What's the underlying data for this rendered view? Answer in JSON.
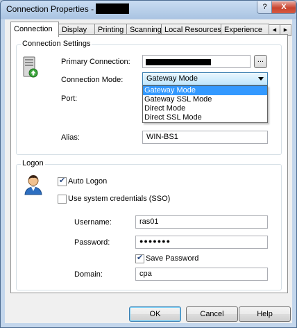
{
  "window": {
    "title": "Connection Properties - ",
    "help_btn": "?",
    "close_btn": "X"
  },
  "tabs": [
    {
      "label": "Connection",
      "active": true
    },
    {
      "label": "Display"
    },
    {
      "label": "Printing"
    },
    {
      "label": "Scanning"
    },
    {
      "label": "Local Resources"
    },
    {
      "label": "Experience"
    }
  ],
  "tab_scroll": {
    "left": "◀",
    "right": "▶"
  },
  "connection_settings": {
    "group_label": "Connection Settings",
    "primary_connection_label": "Primary Connection:",
    "browse_btn": "...",
    "connection_mode_label": "Connection Mode:",
    "connection_mode_value": "Gateway Mode",
    "connection_mode_options": [
      "Gateway Mode",
      "Gateway SSL Mode",
      "Direct Mode",
      "Direct SSL Mode"
    ],
    "port_label": "Port:",
    "alias_label": "Alias:",
    "alias_value": "WIN-BS1"
  },
  "logon": {
    "group_label": "Logon",
    "auto_logon_label": "Auto Logon",
    "auto_logon_checked": true,
    "sso_label": "Use system credentials (SSO)",
    "sso_checked": false,
    "username_label": "Username:",
    "username_value": "ras01",
    "password_label": "Password:",
    "password_value": "●●●●●●●",
    "save_password_label": "Save Password",
    "save_password_checked": true,
    "domain_label": "Domain:",
    "domain_value": "cpa"
  },
  "buttons": {
    "ok": "OK",
    "cancel": "Cancel",
    "help": "Help"
  }
}
